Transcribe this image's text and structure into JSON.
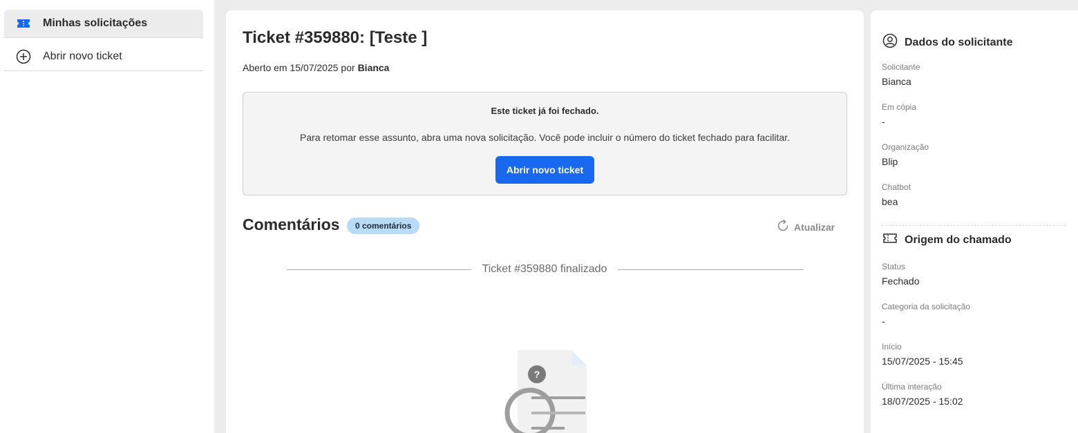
{
  "sidebar": {
    "items": [
      {
        "label": "Minhas solicitações",
        "icon": "ticket-icon",
        "active": true
      },
      {
        "label": "Abrir novo ticket",
        "icon": "plus-circle-icon",
        "active": false
      }
    ]
  },
  "ticket": {
    "title": "Ticket #359880: [Teste ]",
    "opened_prefix": "Aberto em 15/07/2025 por",
    "opened_by": "Bianca"
  },
  "closed_notice": {
    "title": "Este ticket já foi fechado.",
    "text": "Para retomar esse assunto, abra uma nova solicitação. Você pode incluir o número do ticket fechado para facilitar.",
    "button": "Abrir novo ticket"
  },
  "comments": {
    "heading": "Comentários",
    "badge": "0 comentários",
    "refresh": "Atualizar",
    "finalized": "Ticket #359880 finalizado"
  },
  "requester": {
    "heading": "Dados do solicitante",
    "fields": [
      {
        "label": "Solicitante",
        "value": "Bianca"
      },
      {
        "label": "Em cópia",
        "value": "-"
      },
      {
        "label": "Organização",
        "value": "Blip"
      },
      {
        "label": "Chatbot",
        "value": "bea"
      }
    ]
  },
  "origin": {
    "heading": "Origem do chamado",
    "fields": [
      {
        "label": "Status",
        "value": "Fechado"
      },
      {
        "label": "Categoria da solicitação",
        "value": "-"
      },
      {
        "label": "Início",
        "value": "15/07/2025 - 15:45"
      },
      {
        "label": "Última interação",
        "value": "18/07/2025 - 15:02"
      }
    ]
  },
  "colors": {
    "primary": "#1968f0",
    "badge_bg": "#b8dcf8",
    "background": "#ececec"
  }
}
